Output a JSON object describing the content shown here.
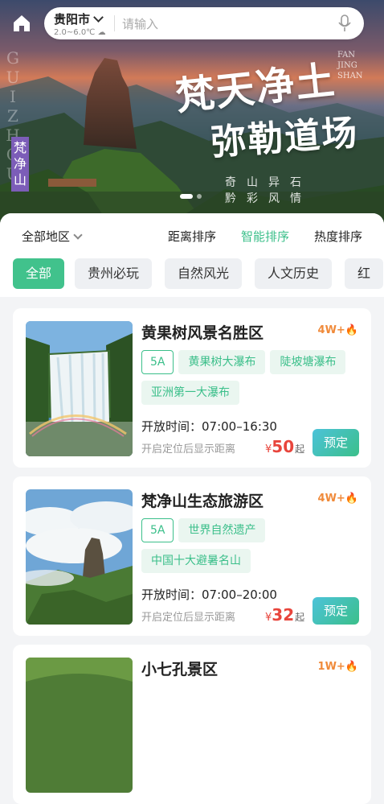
{
  "header": {
    "city": "贵阳市",
    "weather": "2.0~6.0℃",
    "search_placeholder": "请输入"
  },
  "banner": {
    "vertical_text": "GUIZHOU",
    "place_tag": "梵净山",
    "line1": "梵天净土",
    "line2": "弥勒道场",
    "pinyin": [
      "FAN",
      "JING",
      "SHAN"
    ],
    "slogan1": "奇山异石",
    "slogan2": "黔彩风情",
    "dots": 2,
    "active_dot": 0
  },
  "filters": {
    "region": "全部地区",
    "sorts": [
      "距离排序",
      "智能排序",
      "热度排序"
    ],
    "active_sort": 1
  },
  "categories": [
    "全部",
    "贵州必玩",
    "自然风光",
    "人文历史",
    "红"
  ],
  "active_category": 0,
  "spots": [
    {
      "name": "黄果树风景名胜区",
      "heat": "4W+",
      "grade": "5A",
      "tags": [
        "黄果树大瀑布",
        "陡坡塘瀑布",
        "亚洲第一大瀑布"
      ],
      "hours": "开放时间：07:00–16:30",
      "distance": "开启定位后显示距离",
      "price_symbol": "¥",
      "price": "50",
      "price_suffix": "起",
      "book": "预定"
    },
    {
      "name": "梵净山生态旅游区",
      "heat": "4W+",
      "grade": "5A",
      "tags": [
        "世界自然遗产",
        "中国十大避暑名山"
      ],
      "hours": "开放时间：07:00–20:00",
      "distance": "开启定位后显示距离",
      "price_symbol": "¥",
      "price": "32",
      "price_suffix": "起",
      "book": "预定"
    },
    {
      "name": "小七孔景区",
      "heat": "1W+"
    }
  ]
}
